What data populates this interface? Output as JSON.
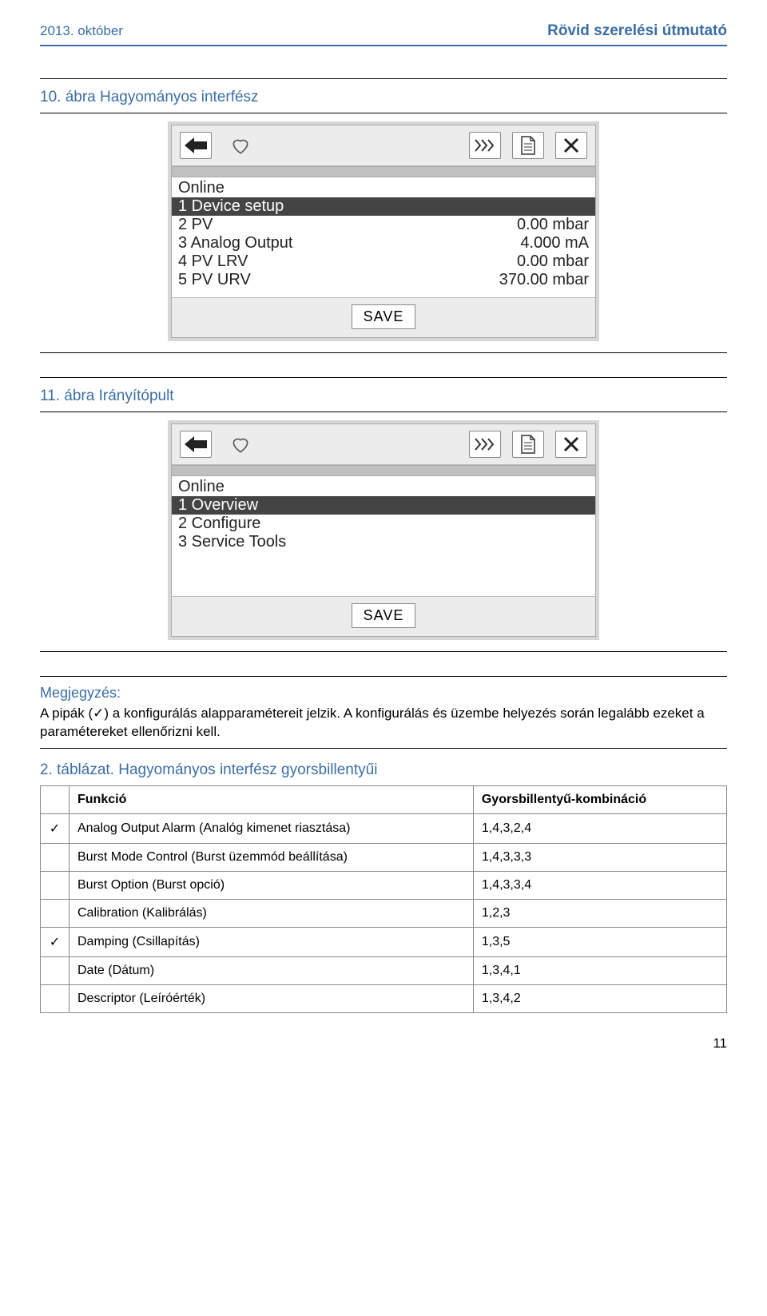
{
  "header": {
    "left": "2013. október",
    "right": "Rövid szerelési útmutató"
  },
  "figures": [
    {
      "title": "10. ábra  Hagyományos interfész",
      "device": {
        "header": "Online",
        "save_label": "SAVE",
        "rows": [
          {
            "left": "1 Device setup",
            "right": "",
            "selected": true
          },
          {
            "left": "2 PV",
            "right": "0.00 mbar",
            "selected": false
          },
          {
            "left": "3 Analog Output",
            "right": "4.000 mA",
            "selected": false
          },
          {
            "left": "4 PV LRV",
            "right": "0.00 mbar",
            "selected": false
          },
          {
            "left": "5 PV URV",
            "right": "370.00 mbar",
            "selected": false
          }
        ]
      }
    },
    {
      "title": "11. ábra  Irányítópult",
      "device": {
        "header": "Online",
        "save_label": "SAVE",
        "rows": [
          {
            "left": "1 Overview",
            "right": "",
            "selected": true
          },
          {
            "left": "2 Configure",
            "right": "",
            "selected": false
          },
          {
            "left": "3 Service Tools",
            "right": "",
            "selected": false
          }
        ],
        "min_height": 150
      }
    }
  ],
  "note": {
    "heading": "Megjegyzés:",
    "body": "A pipák (✓) a konfigurálás alapparamétereit jelzik. A konfigurálás és üzembe helyezés során legalább ezeket a paramétereket ellenőrizni kell."
  },
  "table": {
    "title": "2. táblázat.  Hagyományos interfész gyorsbillentyűi",
    "col_function": "Funkció",
    "col_shortcut": "Gyorsbillentyű-kombináció",
    "rows": [
      {
        "check": "✓",
        "func": "Analog Output Alarm (Analóg kimenet riasztása)",
        "keys": "1,4,3,2,4"
      },
      {
        "check": "",
        "func": "Burst Mode Control (Burst üzemmód beállítása)",
        "keys": "1,4,3,3,3"
      },
      {
        "check": "",
        "func": "Burst Option (Burst opció)",
        "keys": "1,4,3,3,4"
      },
      {
        "check": "",
        "func": "Calibration (Kalibrálás)",
        "keys": "1,2,3"
      },
      {
        "check": "✓",
        "func": "Damping (Csillapítás)",
        "keys": "1,3,5"
      },
      {
        "check": "",
        "func": "Date (Dátum)",
        "keys": "1,3,4,1"
      },
      {
        "check": "",
        "func": "Descriptor (Leíróérték)",
        "keys": "1,3,4,2"
      }
    ]
  },
  "page_number": "11"
}
